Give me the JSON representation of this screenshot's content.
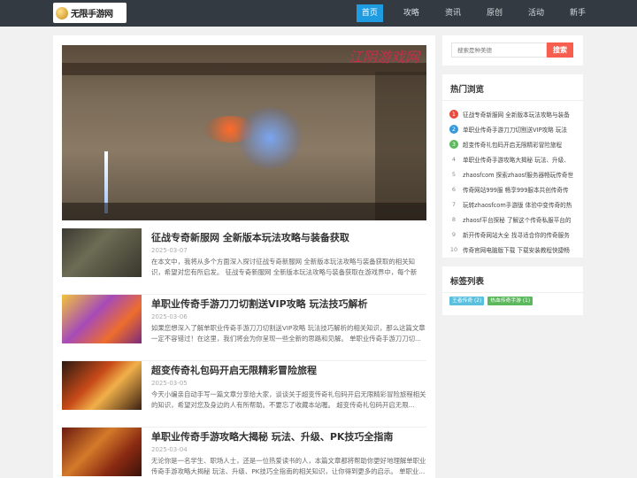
{
  "header": {
    "logo_text": "无限手游网",
    "nav": [
      "首页",
      "攻略",
      "资讯",
      "原创",
      "活动",
      "新手"
    ]
  },
  "banner": {
    "overlay_text": "江阴游戏网"
  },
  "articles": [
    {
      "title": "征战专奇新服网 全新版本玩法攻略与装备获取",
      "date": "2025-03-07",
      "desc": "在本文中，我将从多个方面深入探讨征战专奇新服网 全新版本玩法攻略与装备获取的相关知识，希望对您有所启发。 征战专奇新服网 全新版本玩法攻略与装备获取在游戏界中，每个新版..."
    },
    {
      "title": "单职业传奇手游刀刀切割送VIP攻略 玩法技巧解析",
      "date": "2025-03-06",
      "desc": "如果您想深入了解单职业传奇手游刀刀切割送VIP攻略 玩法技巧解析的相关知识，那么这篇文章一定不容错过！在这里，我们将会为你呈现一些全新的思路和见解。 单职业传奇手游刀刀切..."
    },
    {
      "title": "超变传奇礼包码开启无限精彩冒险旅程",
      "date": "2025-03-05",
      "desc": "今天小编亲自动手写一篇文章分享给大家，谈谈关于超变传奇礼包码开启无限精彩冒险旅程相关的知识，希望对您及身边的人有所帮助。不要忘了收藏本站喔。 超变传奇礼包码开启无限..."
    },
    {
      "title": "单职业传奇手游攻略大揭秘 玩法、升级、PK技巧全指南",
      "date": "2025-03-04",
      "desc": "无论你是一名学生、职场人士，还是一位热爱读书的人，本篇文章都将帮助你更好地理解单职业传奇手游攻略大揭秘 玩法、升级、PK技巧全指南的相关知识，让你得到更多的启示。 单职业..."
    }
  ],
  "search": {
    "placeholder": "搜索是种美德",
    "button": "搜索"
  },
  "hot": {
    "title": "热门浏览",
    "items": [
      "征战专奇新服网 全新版本玩法攻略与装备",
      "单职业传奇手游刀刀切割送VIP攻略 玩法",
      "超变传奇礼包码开启无限精彩冒险旅程",
      "单职业传奇手游攻略大揭秘 玩法、升级、",
      "zhaosfcom 探索zhaosf服务器畅玩传奇世",
      "传奇网站999服 畅享999服本共创传奇传",
      "玩转zhaosfcom手游版 体验中变传奇的热",
      "zhaosf平台探秘 了解这个传奇私服平台的",
      "新开传奇网站大全 找寻适合你的传奇服务",
      "传奇官网电脑版下载 下载安装教程快捷畅"
    ],
    "numbers": [
      "1",
      "2",
      "3",
      "4",
      "5",
      "6",
      "7",
      "8",
      "9",
      "10"
    ]
  },
  "tags": {
    "title": "标签列表",
    "items": [
      "王者传奇 (2)",
      "热血传奇手游 (1)"
    ]
  }
}
